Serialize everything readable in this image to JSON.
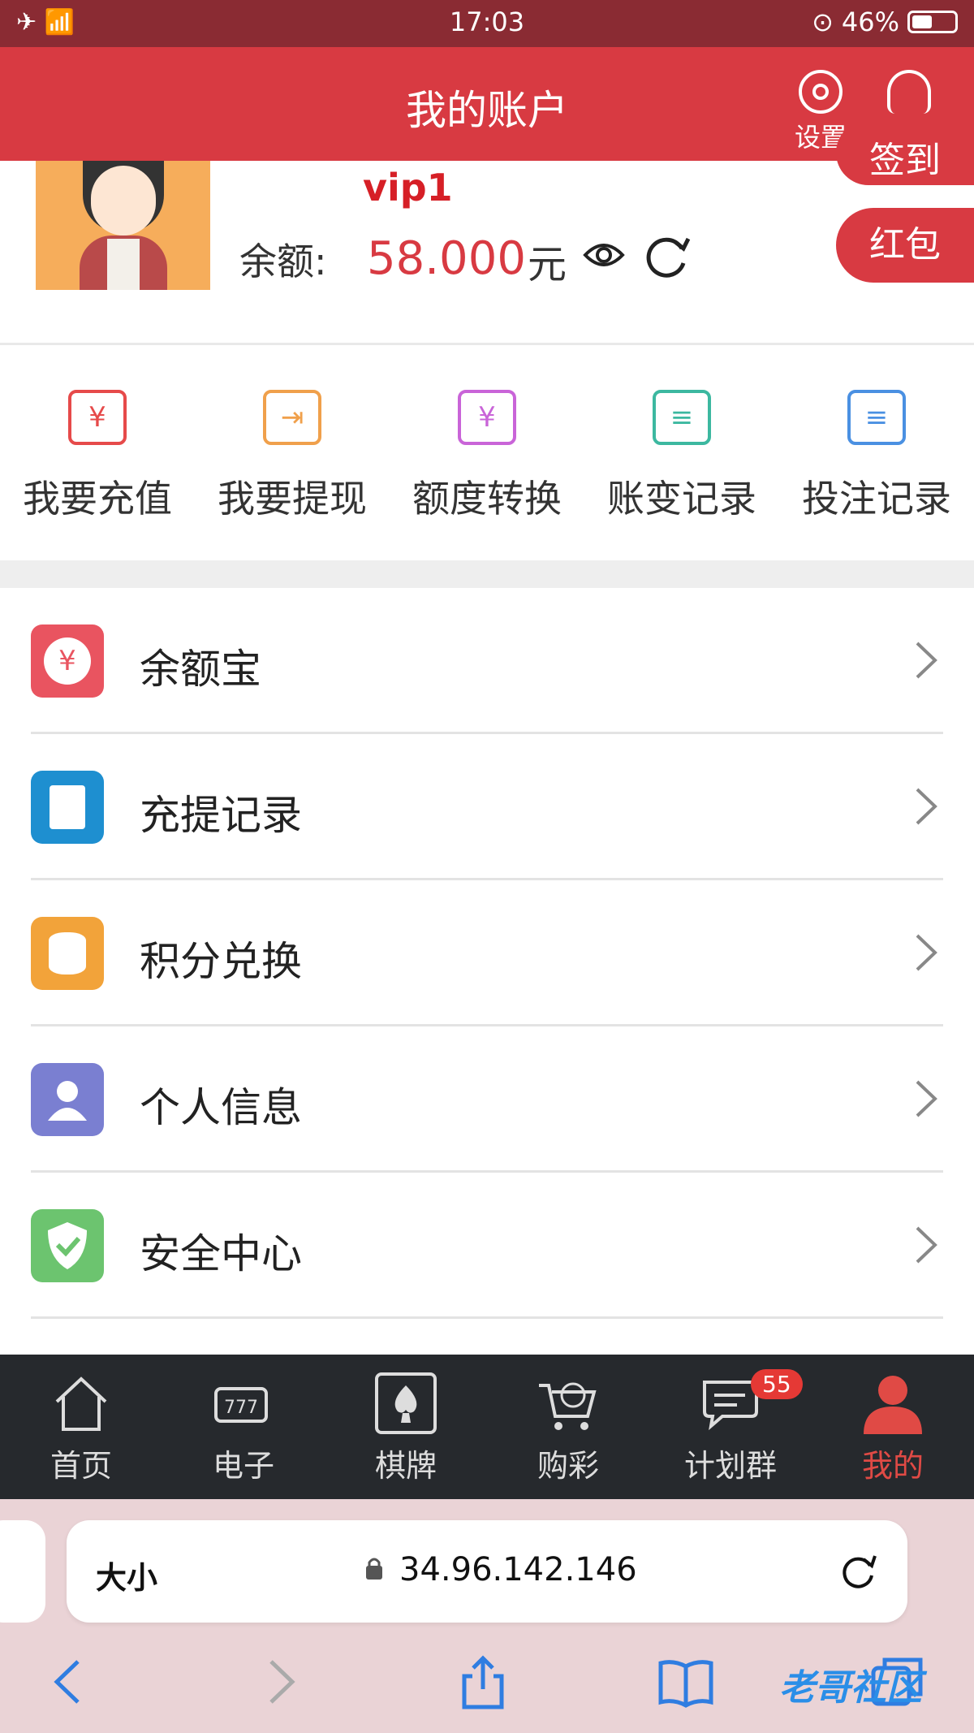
{
  "status": {
    "time": "17:03",
    "battery": "46%"
  },
  "header": {
    "title": "我的账户",
    "settings": "设置",
    "service": "客服"
  },
  "profile": {
    "vip": "vip1",
    "balance_label": "余额:",
    "balance_value": "58.000",
    "balance_unit": "元",
    "signin_label": "签到",
    "redpacket_label": "红包"
  },
  "quick_actions": [
    {
      "label": "我要充值",
      "icon": "recharge-icon",
      "color": "#e64a4a"
    },
    {
      "label": "我要提现",
      "icon": "withdraw-icon",
      "color": "#f0a04b"
    },
    {
      "label": "额度转换",
      "icon": "transfer-icon",
      "color": "#c964d8"
    },
    {
      "label": "账变记录",
      "icon": "account-change-icon",
      "color": "#3cb8a0"
    },
    {
      "label": "投注记录",
      "icon": "bet-record-icon",
      "color": "#4a90e2"
    }
  ],
  "menu": [
    {
      "label": "余额宝",
      "icon": "yuebao-icon",
      "color": "#e95460"
    },
    {
      "label": "充提记录",
      "icon": "record-icon",
      "color": "#1e8fd0"
    },
    {
      "label": "积分兑换",
      "icon": "points-icon",
      "color": "#f2a33a"
    },
    {
      "label": "个人信息",
      "icon": "user-icon",
      "color": "#7a7fd1"
    },
    {
      "label": "安全中心",
      "icon": "shield-icon",
      "color": "#6cc46f"
    }
  ],
  "tabbar": [
    {
      "label": "首页",
      "icon": "home-icon"
    },
    {
      "label": "电子",
      "icon": "slot-icon"
    },
    {
      "label": "棋牌",
      "icon": "cards-icon"
    },
    {
      "label": "购彩",
      "icon": "lottery-cart-icon"
    },
    {
      "label": "计划群",
      "icon": "chat-icon",
      "badge": "55"
    },
    {
      "label": "我的",
      "icon": "person-icon",
      "active": true
    }
  ],
  "browser": {
    "size_label": "大小",
    "url": "34.96.142.146",
    "watermark": "老哥社区"
  }
}
